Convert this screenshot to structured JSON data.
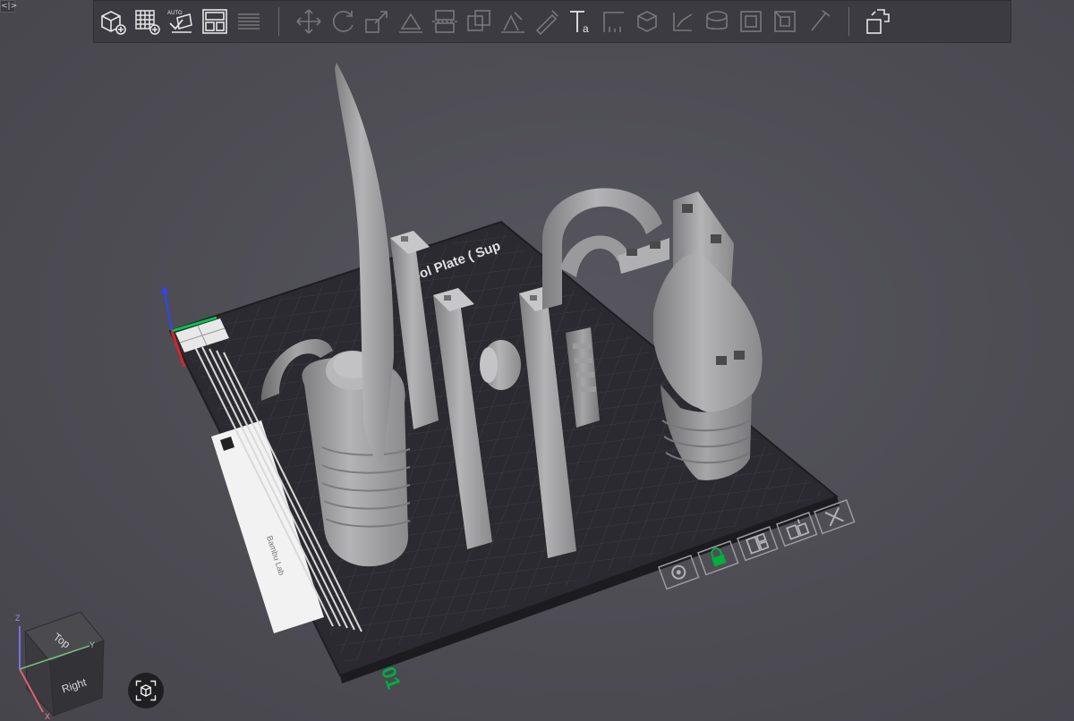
{
  "corner_toggle": {
    "label": "<|>"
  },
  "toolbar": {
    "buttons": [
      {
        "name": "add-object-icon",
        "enabled": true
      },
      {
        "name": "add-plate-icon",
        "enabled": true
      },
      {
        "name": "auto-orient-icon",
        "enabled": true,
        "caption": "AUTO"
      },
      {
        "name": "arrange-icon",
        "enabled": true
      },
      {
        "name": "split-to-plates-icon",
        "enabled": false
      },
      {
        "name": "move-icon",
        "enabled": false
      },
      {
        "name": "rotate-icon",
        "enabled": false
      },
      {
        "name": "scale-icon",
        "enabled": false
      },
      {
        "name": "lay-on-face-icon",
        "enabled": false
      },
      {
        "name": "cut-icon",
        "enabled": false
      },
      {
        "name": "mesh-boolean-icon",
        "enabled": false
      },
      {
        "name": "support-paint-icon",
        "enabled": false
      },
      {
        "name": "seam-paint-icon",
        "enabled": false
      },
      {
        "name": "text-tool-icon",
        "enabled": true,
        "caption": "Ta"
      },
      {
        "name": "measure-icon",
        "enabled": false
      },
      {
        "name": "assembly-icon",
        "enabled": false
      },
      {
        "name": "variable-layer-icon",
        "enabled": false
      },
      {
        "name": "color-paint-icon",
        "enabled": false
      },
      {
        "name": "fuzzy-skin-icon",
        "enabled": false
      },
      {
        "name": "brim-ears-icon",
        "enabled": false
      },
      {
        "name": "emboss-icon",
        "enabled": false
      },
      {
        "name": "svg-icon",
        "enabled": false
      },
      {
        "name": "explode-icon",
        "enabled": true
      }
    ]
  },
  "plate": {
    "name_label": "Cool Plate ( Sup",
    "number_label": "01",
    "top_label": "A",
    "qr_caption": "Bambu Lab"
  },
  "plate_actions": [
    {
      "name": "plate-settings-icon"
    },
    {
      "name": "lock-plate-icon",
      "state": "locked",
      "color": "#00ae42"
    },
    {
      "name": "arrange-plate-icon"
    },
    {
      "name": "auto-orient-plate-icon"
    },
    {
      "name": "delete-plate-icon"
    }
  ],
  "view_cube": {
    "top_label": "Top",
    "right_label": "Right",
    "axes": {
      "z": "Z",
      "y": "Y",
      "x": "X"
    }
  },
  "colors": {
    "accent": "#00ae42",
    "background": "#4d4c53",
    "plate": "#2b2a30",
    "model": "#a5a5a5"
  }
}
